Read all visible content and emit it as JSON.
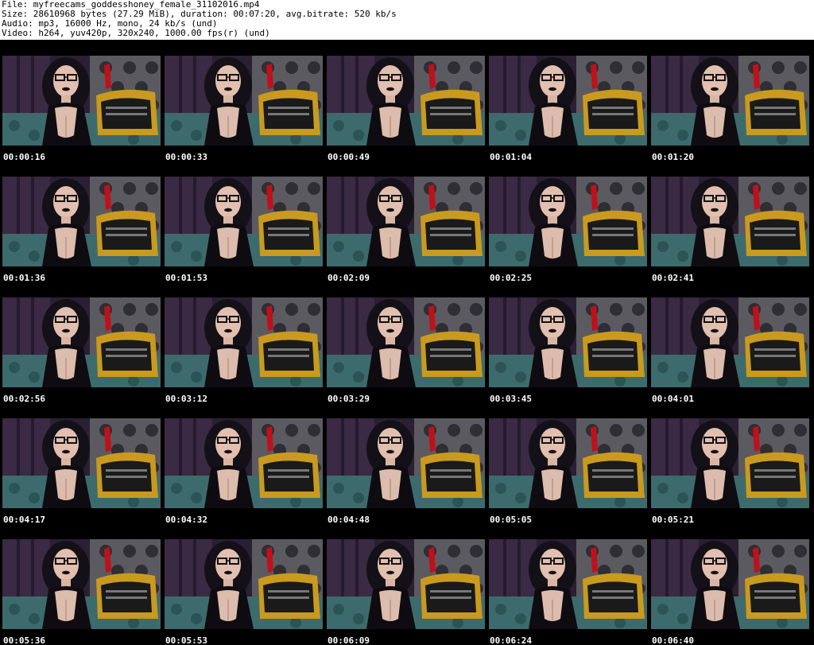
{
  "header": {
    "file_line": "File: myfreecams_goddesshoney_female_31102016.mp4",
    "size_line": "Size: 28610968 bytes (27.29 MiB), duration: 00:07:20, avg.bitrate: 520 kb/s",
    "audio_line": "Audio: mp3, 16000 Hz, mono, 24 kb/s (und)",
    "video_line": "Video: h264, yuv420p, 320x240, 1000.00 fps(r) (und)"
  },
  "colors": {
    "sheet_background": "#ffffff",
    "grid_background": "#000000",
    "timestamp_text": "#ffffff",
    "header_text": "#000000"
  },
  "thumbnails": [
    {
      "time": "00:00:16"
    },
    {
      "time": "00:00:33"
    },
    {
      "time": "00:00:49"
    },
    {
      "time": "00:01:04"
    },
    {
      "time": "00:01:20"
    },
    {
      "time": "00:01:36"
    },
    {
      "time": "00:01:53"
    },
    {
      "time": "00:02:09"
    },
    {
      "time": "00:02:25"
    },
    {
      "time": "00:02:41"
    },
    {
      "time": "00:02:56"
    },
    {
      "time": "00:03:12"
    },
    {
      "time": "00:03:29"
    },
    {
      "time": "00:03:45"
    },
    {
      "time": "00:04:01"
    },
    {
      "time": "00:04:17"
    },
    {
      "time": "00:04:32"
    },
    {
      "time": "00:04:48"
    },
    {
      "time": "00:05:05"
    },
    {
      "time": "00:05:21"
    },
    {
      "time": "00:05:36"
    },
    {
      "time": "00:05:53"
    },
    {
      "time": "00:06:09"
    },
    {
      "time": "00:06:24"
    },
    {
      "time": "00:06:40"
    }
  ]
}
